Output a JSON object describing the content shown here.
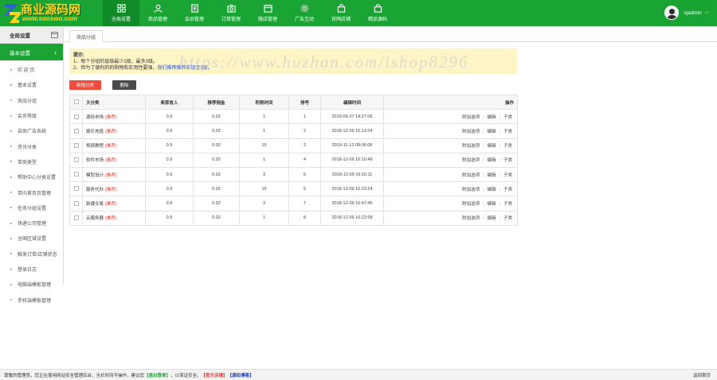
{
  "logo": {
    "title": "商业源码网",
    "subtitle": "www.sooswo.com"
  },
  "nav": [
    {
      "label": "全局设置",
      "icon": "grid-icon",
      "active": true
    },
    {
      "label": "商品管理",
      "icon": "user-icon"
    },
    {
      "label": "会员管理",
      "icon": "document-icon"
    },
    {
      "label": "订单管理",
      "icon": "camera-icon"
    },
    {
      "label": "微店管理",
      "icon": "calendar-icon"
    },
    {
      "label": "广告互动",
      "icon": "gear-icon"
    },
    {
      "label": "官网店铺",
      "icon": "bag-icon"
    },
    {
      "label": "精品源码",
      "icon": "bag-icon"
    }
  ],
  "user": {
    "name": "sjadmin"
  },
  "sidebar": {
    "header": "全局设置",
    "section": "基本设置",
    "items": [
      "欢 迎 页",
      "基本设置",
      "商品分组",
      "会员等级",
      "自助广告系统",
      "资讯分类",
      "单商类型",
      "帮助中心分类设置",
      "单向首页页管理",
      "任务分组设置",
      "快递公司管理",
      "全国区域设置",
      "触发订单/店铺状态",
      "登录日志",
      "电脑端模板管理",
      "手机端模板管理"
    ]
  },
  "tab": "商品分组",
  "tips": {
    "title": "提示:",
    "line1": "1、每个分组的层级最少1级，最多3级。",
    "line2": "2、但为了便利的的购物和实用性要强，",
    "link": "我们推荐推荐实现至3级。"
  },
  "watermark": "https://www.huzhan.com/ishop8296",
  "buttons": {
    "add": "新增分类",
    "delete": "删除"
  },
  "table": {
    "headers": [
      "大分类",
      "卖家收入",
      "推荐佣金",
      "积税时间",
      "排号",
      "编辑时间",
      "操作"
    ],
    "recommend_tag": "(推荐)",
    "op_labels": [
      "附加选项",
      "编辑",
      "子类"
    ],
    "rows": [
      {
        "name": "源码市场",
        "income": "0.9",
        "commission": "0.02",
        "period": "1",
        "order": "1",
        "time": "2019-09-27 14:27:06"
      },
      {
        "name": "娱乐充值",
        "income": "0.9",
        "commission": "0.02",
        "period": "1",
        "order": "2",
        "time": "2018-12-09 16:12:04"
      },
      {
        "name": "视频教程",
        "income": "0.9",
        "commission": "0.02",
        "period": "15",
        "order": "3",
        "time": "2019-11-13 08:06:08"
      },
      {
        "name": "软件市场",
        "income": "0.9",
        "commission": "0.02",
        "period": "1",
        "order": "4",
        "time": "2018-12-09 16:10:49"
      },
      {
        "name": "模型设计",
        "income": "0.9",
        "commission": "0.02",
        "period": "3",
        "order": "5",
        "time": "2018-12-09 16:10:11"
      },
      {
        "name": "服务代办",
        "income": "0.9",
        "commission": "0.02",
        "period": "15",
        "order": "6",
        "time": "2018-12-09 16:23:24"
      },
      {
        "name": "新媒交易",
        "income": "0.9",
        "commission": "0.02",
        "period": "3",
        "order": "7",
        "time": "2018-12-09 16:47:45"
      },
      {
        "name": "云服务器",
        "income": "0.9",
        "commission": "0.02",
        "period": "1",
        "order": "8",
        "time": "2018-12-09 16:22:58"
      }
    ]
  },
  "footer": {
    "text1": "尊敬的管理员，您正在使用网站安全管理后台，当长时间不操作，建议您",
    "logout": "【退出登录】",
    "text2": "，以保证安全。",
    "official": "【官方店铺】",
    "source": "【源码博客】",
    "home": "返回首页"
  },
  "colors": {
    "brand": "#1aa434",
    "brand_dark": "#118a28",
    "danger": "#ef4c3d",
    "tip_bg": "#fdf5c5"
  }
}
